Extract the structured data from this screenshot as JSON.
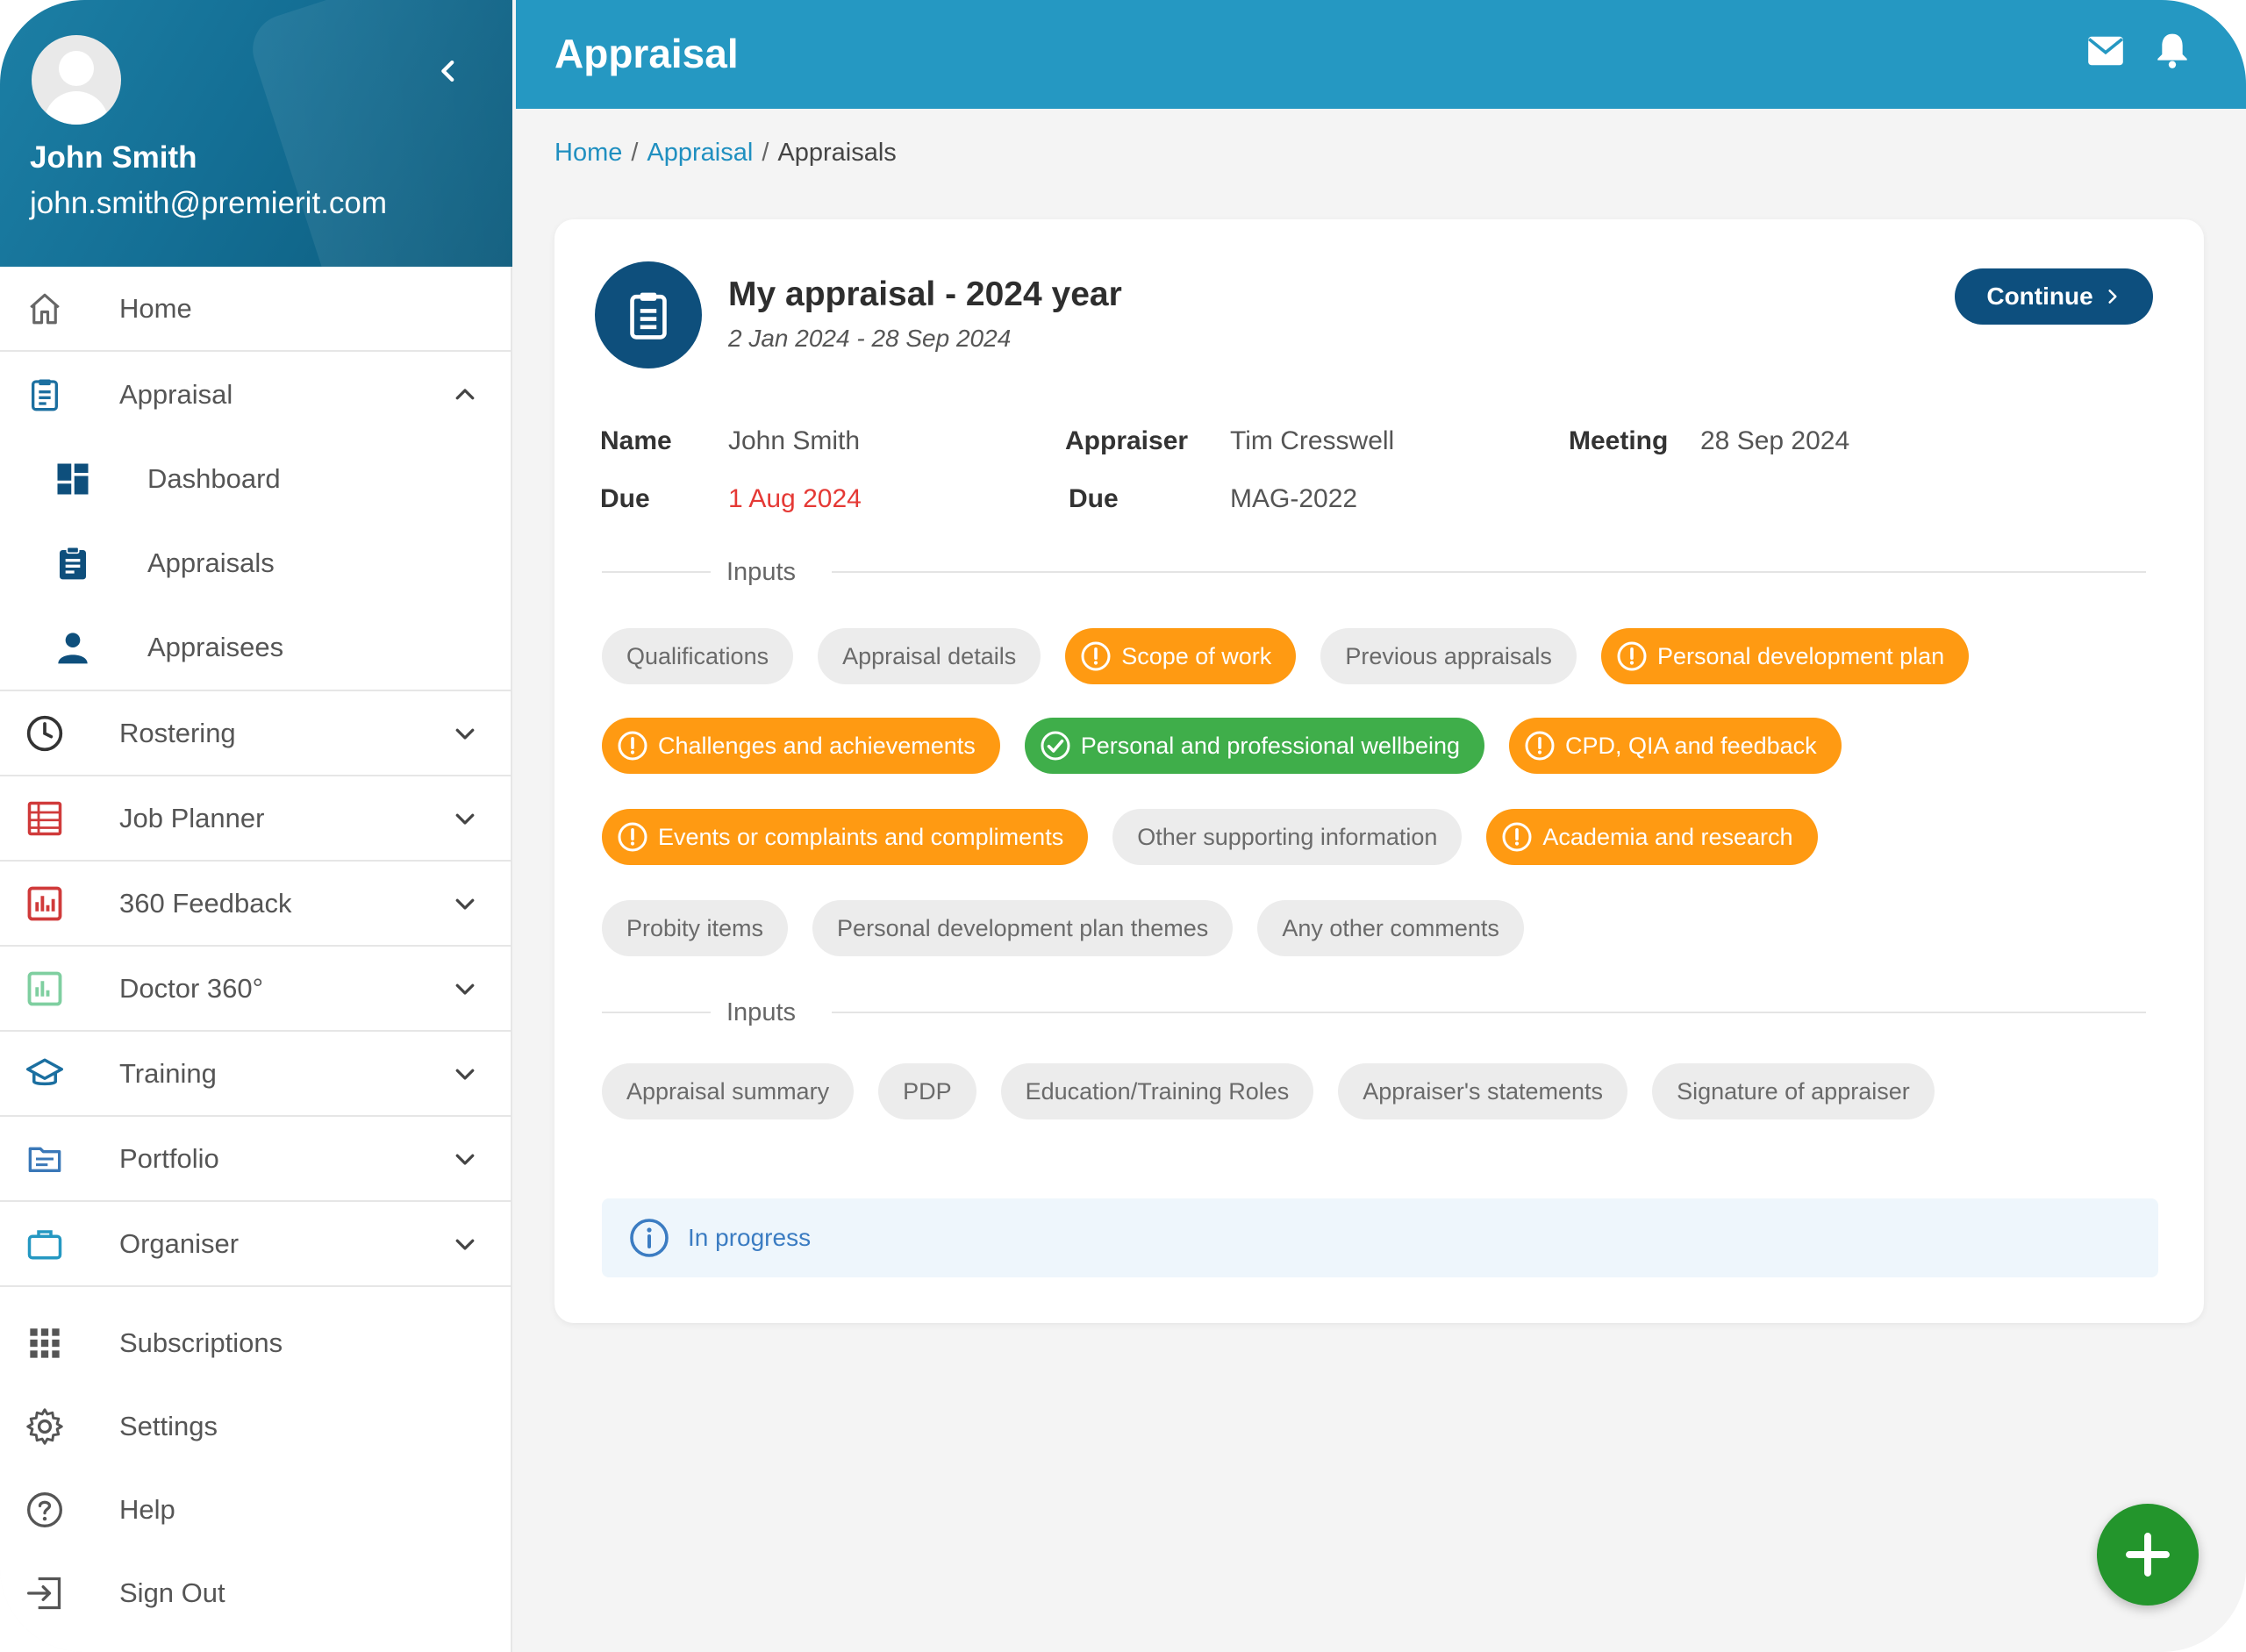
{
  "user": {
    "name": "John Smith",
    "email": "john.smith@premierit.com"
  },
  "sidebar": {
    "items": [
      {
        "label": "Home",
        "icon": "home-icon"
      },
      {
        "label": "Appraisal",
        "icon": "clipboard-icon"
      },
      {
        "label": "Rostering",
        "icon": "clock-icon"
      },
      {
        "label": "Job Planner",
        "icon": "table-icon"
      },
      {
        "label": "360 Feedback",
        "icon": "bar-chart-icon"
      },
      {
        "label": "Doctor 360°",
        "icon": "bar-chart-icon"
      },
      {
        "label": "Training",
        "icon": "graduation-cap-icon"
      },
      {
        "label": "Portfolio",
        "icon": "folder-icon"
      },
      {
        "label": "Organiser",
        "icon": "briefcase-icon"
      }
    ],
    "appraisal_sub": [
      {
        "label": "Dashboard",
        "icon": "dashboard-icon"
      },
      {
        "label": "Appraisals",
        "icon": "clipboard-icon"
      },
      {
        "label": "Appraisees",
        "icon": "person-icon"
      }
    ],
    "bottom": [
      {
        "label": "Subscriptions",
        "icon": "grid-icon"
      },
      {
        "label": "Settings",
        "icon": "gear-icon"
      },
      {
        "label": "Help",
        "icon": "help-icon"
      },
      {
        "label": "Sign Out",
        "icon": "sign-out-icon"
      }
    ]
  },
  "header": {
    "title": "Appraisal"
  },
  "breadcrumb": {
    "home": "Home",
    "section": "Appraisal",
    "current": "Appraisals",
    "separator": "/"
  },
  "appraisal": {
    "title": "My appraisal - 2024 year",
    "dates": "2 Jan 2024 - 28 Sep 2024",
    "continue_label": "Continue",
    "name_label": "Name",
    "name_value": "John Smith",
    "appraiser_label": "Appraiser",
    "appraiser_value": "Tim Cresswell",
    "meeting_label": "Meeting",
    "meeting_value": "28 Sep 2024",
    "due_label": "Due",
    "due_value": "1 Aug 2024",
    "due2_label": "Due",
    "due2_value": "MAG-2022",
    "section1_label": "Inputs",
    "section2_label": "Inputs",
    "chips_row1": [
      {
        "label": "Qualifications",
        "status": "none"
      },
      {
        "label": "Appraisal details",
        "status": "none"
      },
      {
        "label": "Scope of work",
        "status": "warning"
      },
      {
        "label": "Previous appraisals",
        "status": "none"
      },
      {
        "label": "Personal development plan",
        "status": "warning"
      }
    ],
    "chips_row2": [
      {
        "label": "Challenges and achievements",
        "status": "warning"
      },
      {
        "label": "Personal and professional wellbeing",
        "status": "complete"
      },
      {
        "label": "CPD, QIA and feedback",
        "status": "warning"
      }
    ],
    "chips_row3": [
      {
        "label": "Events or complaints and compliments",
        "status": "warning"
      },
      {
        "label": "Other supporting information",
        "status": "none"
      },
      {
        "label": "Academia and research",
        "status": "warning"
      }
    ],
    "chips_row4": [
      {
        "label": "Probity items",
        "status": "none"
      },
      {
        "label": "Personal development plan themes",
        "status": "none"
      },
      {
        "label": "Any other comments",
        "status": "none"
      }
    ],
    "chips_row5": [
      {
        "label": "Appraisal summary",
        "status": "none"
      },
      {
        "label": "PDP",
        "status": "none"
      },
      {
        "label": "Education/Training Roles",
        "status": "none"
      },
      {
        "label": "Appraiser's statements",
        "status": "none"
      },
      {
        "label": "Signature of appraiser",
        "status": "none"
      }
    ],
    "status_text": "In progress"
  },
  "colors": {
    "header": "#2598c2",
    "profile": "#146f95",
    "primary_button": "#0d4f7e",
    "warning": "#ff9a12",
    "complete": "#3fae4a",
    "fab": "#23952c",
    "due_red": "#e53935",
    "link": "#1f8fc0"
  }
}
